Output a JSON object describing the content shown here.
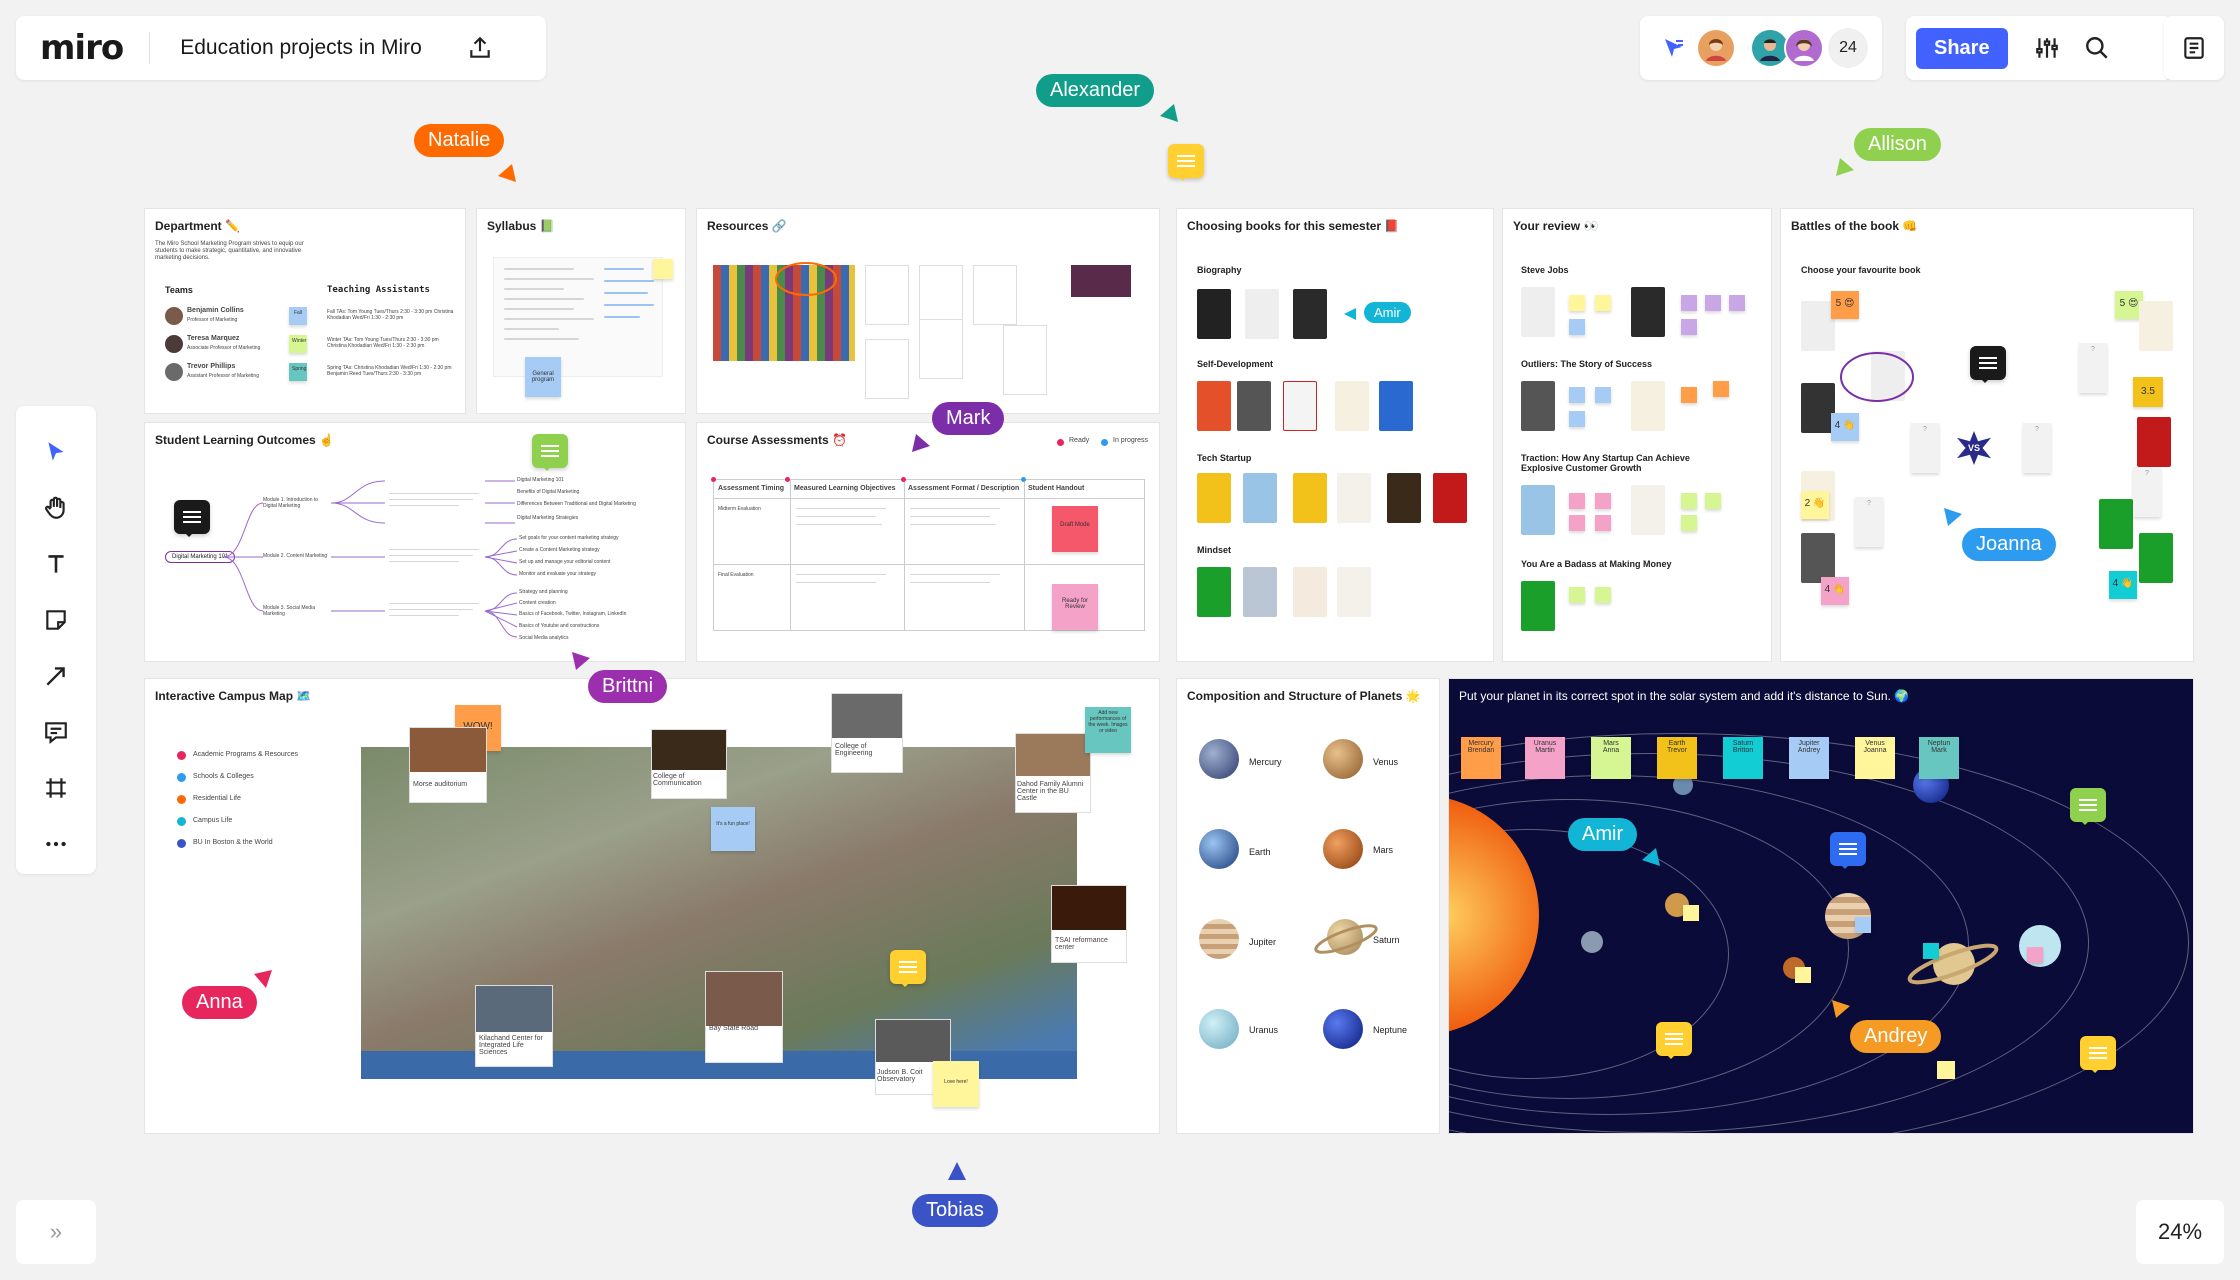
{
  "app": {
    "logo": "miro",
    "board_title": "Education projects in Miro",
    "share_label": "Share",
    "collaborator_count": "24",
    "zoom": "24%",
    "expand_label": "»"
  },
  "colors": {
    "accent": "#4262ff",
    "natalie": "#ff6a00",
    "alexander": "#109e8a",
    "allison": "#8fd14f",
    "mark": "#7b2ea8",
    "brittni": "#9b2fae",
    "joanna": "#2d9bf0",
    "amir": "#12b5d6",
    "anna": "#e8265e",
    "andrey": "#f59b23",
    "tobias": "#3a54c7"
  },
  "cursors": {
    "natalie": "Natalie",
    "alexander": "Alexander",
    "allison": "Allison",
    "mark": "Mark",
    "brittni": "Brittni",
    "joanna": "Joanna",
    "amir_books": "Amir",
    "amir_planets": "Amir",
    "anna": "Anna",
    "andrey": "Andrey",
    "tobias": "Tobias"
  },
  "frames": {
    "department": {
      "title": "Department ✏️",
      "intro": "The Miro School Marketing Program strives to equip our students to make strategic, quantitative, and innovative marketing decisions.",
      "teams": "Teams",
      "ta": "Teaching Assistants",
      "people": [
        {
          "name": "Benjamin Collins",
          "role": "Professor of Marketing",
          "schedule": "Fall TAs: Tom Young Tues/Thurs 2:30 - 3:30 pm Christina Khodadian Wed/Fri 1:30 - 2:30 pm",
          "tag": "Fall"
        },
        {
          "name": "Teresa Marquez",
          "role": "Associate Professor of Marketing",
          "schedule": "Winter TAs: Tom Young Tues/Thurs 2:30 - 3:30 pm Christina Khodadian Wed/Fri 1:30 - 2:30 pm",
          "tag": "Winter"
        },
        {
          "name": "Trevor Phillips",
          "role": "Assistant Professor of Marketing",
          "schedule": "Spring TAs: Christina Khodadian Wed/Fri 1:30 - 2:30 pm Benjamin Reed Tues/Thurs 2:30 - 3:30 pm",
          "tag": "Spring"
        }
      ]
    },
    "syllabus": {
      "title": "Syllabus 📗",
      "sticky": "General program"
    },
    "resources": {
      "title": "Resources 🔗"
    },
    "books": {
      "title": "Choosing books for this semester 📕",
      "biography": "Biography",
      "self_dev": "Self-Development",
      "tech": "Tech Startup",
      "mindset": "Mindset"
    },
    "review": {
      "title": "Your review 👀",
      "steve": "Steve Jobs",
      "outliers": "Outliers: The Story of Success",
      "traction": "Traction: How Any Startup Can Achieve Explosive Customer Growth",
      "badass": "You Are a Badass at Making Money"
    },
    "battles": {
      "title": "Battles of the book 👊",
      "prompt": "Choose your favourite book",
      "vs": "VS",
      "votes": [
        "5 😍",
        "5 😍",
        "3.5",
        "4 👋",
        "2 👋",
        "4 👋",
        "4 👋"
      ]
    },
    "outcomes": {
      "title": "Student Learning Outcomes ☝️",
      "root": "Digital Marketing 101",
      "modules": [
        "Module 1. Introduction to Digital Marketing",
        "Module 2. Content Marketing",
        "Module 3. Social Media Marketing"
      ],
      "leaves": [
        "Digital Marketing 101",
        "Benefits of Digital Marketing",
        "Differences Between Traditional and Digital Marketing",
        "Digital Marketing Strategies",
        "Set goals for your content marketing strategy",
        "Create a Content Marketing strategy",
        "Set up and manage your editorial content",
        "Monitor and evaluate your strategy",
        "Strategy and planning",
        "Content creation",
        "Basics of Facebook, Twitter, Instagram, LinkedIn",
        "Basics of Youtube and constructions",
        "Social Media analytics"
      ]
    },
    "assessments": {
      "title": "Course Assessments ⏰",
      "ready": "Ready",
      "progress": "In progress",
      "headers": [
        "Assessment Timing",
        "Measured Learning Objectives",
        "Assessment Format / Description",
        "Student Handout"
      ],
      "row1": "Midterm Evaluation",
      "row2": "Final Evaluation",
      "draft": "Draft Mode",
      "review": "Ready for Review"
    },
    "campus": {
      "title": "Interactive Campus Map 🗺️",
      "legend": [
        "Academic Programs & Resources",
        "Schools & Colleges",
        "Residential Life",
        "Campus Life",
        "BU In Boston & the World"
      ],
      "wow": "WOW!",
      "places": [
        "Morse auditorium",
        "College of Communication",
        "College of Engineering",
        "Dahod Family Alumni Center in the BU Castle",
        "TSAI reformance center",
        "Kilachand Center for Integrated Life Sciences",
        "Bay State Road",
        "Judson B. Coit Observatory"
      ],
      "note_fun": "It's a fun place!",
      "note_perf": "Add new performances of the week. Images or video",
      "note_love": "Love here!"
    },
    "composition": {
      "title": "Composition and Structure of Planets 🌟",
      "planets": [
        "Mercury",
        "Venus",
        "Earth",
        "Mars",
        "Jupiter",
        "Saturn",
        "Uranus",
        "Neptune"
      ]
    },
    "solar": {
      "title": "Put your planet in its correct spot in the solar system and add it's distance to Sun. 🌍",
      "stickies": [
        {
          "planet": "Mercury",
          "name": "Brendan"
        },
        {
          "planet": "Uranus",
          "name": "Martin"
        },
        {
          "planet": "Mars",
          "name": "Anna"
        },
        {
          "planet": "Earth",
          "name": "Trevor"
        },
        {
          "planet": "Saturn",
          "name": "Britton"
        },
        {
          "planet": "Jupiter",
          "name": "Andrey"
        },
        {
          "planet": "Venus",
          "name": "Joanna"
        },
        {
          "planet": "Neptun",
          "name": "Mark"
        }
      ]
    }
  }
}
